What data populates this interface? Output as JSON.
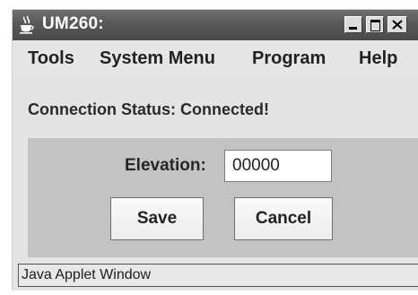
{
  "window": {
    "title": "UM260:",
    "icon": "java-cup-icon"
  },
  "menu": {
    "items": [
      {
        "label": "Tools"
      },
      {
        "label": "System Menu"
      },
      {
        "label": "Program"
      },
      {
        "label": "Help"
      }
    ]
  },
  "status": {
    "text": "Connection Status: Connected!"
  },
  "form": {
    "elevation_label": "Elevation:",
    "elevation_value": "00000"
  },
  "buttons": {
    "save_label": "Save",
    "cancel_label": "Cancel"
  },
  "status_bar": {
    "text": "Java Applet Window"
  }
}
